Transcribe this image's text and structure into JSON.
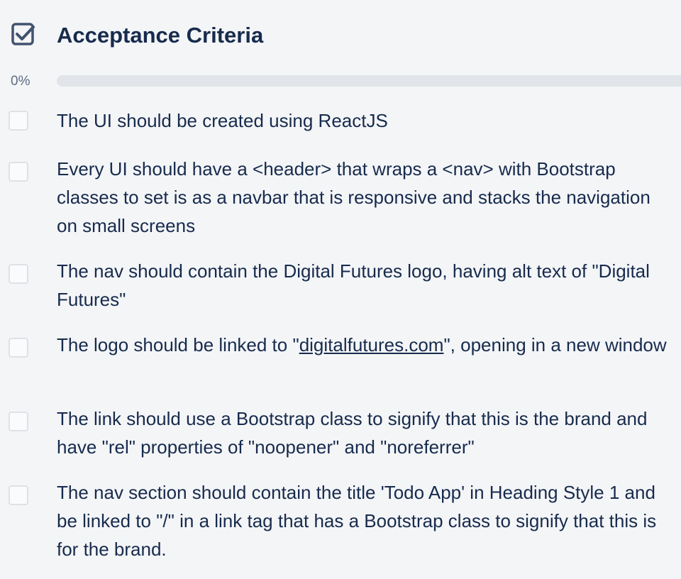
{
  "checklist": {
    "title": "Acceptance Criteria",
    "progress_label": "0%",
    "progress_fraction": 0,
    "icon": "checkbox-checked-icon",
    "items": [
      {
        "text": "The UI should be created using ReactJS",
        "checked": false
      },
      {
        "text": "Every UI should have a <header> that wraps a <nav> with Bootstrap classes to set is as a navbar that is responsive and stacks the navigation on small screens",
        "checked": false
      },
      {
        "text": "The nav should contain the Digital Futures logo, having alt text of \"Digital Futures\"",
        "checked": false
      },
      {
        "text_before": "The logo should be linked to \"",
        "link_text": "digitalfutures.com",
        "text_after": "\", opening in a new window",
        "checked": false
      },
      {
        "text": "The link should use a Bootstrap class to signify that this is the brand and have \"rel\" properties of \"noopener\" and \"noreferrer\"",
        "checked": false
      },
      {
        "text": "The nav section should contain the title 'Todo App' in Heading Style 1 and be linked to \"/\" in a link tag that has a Bootstrap class to signify that this is for the brand.",
        "checked": false
      }
    ]
  }
}
